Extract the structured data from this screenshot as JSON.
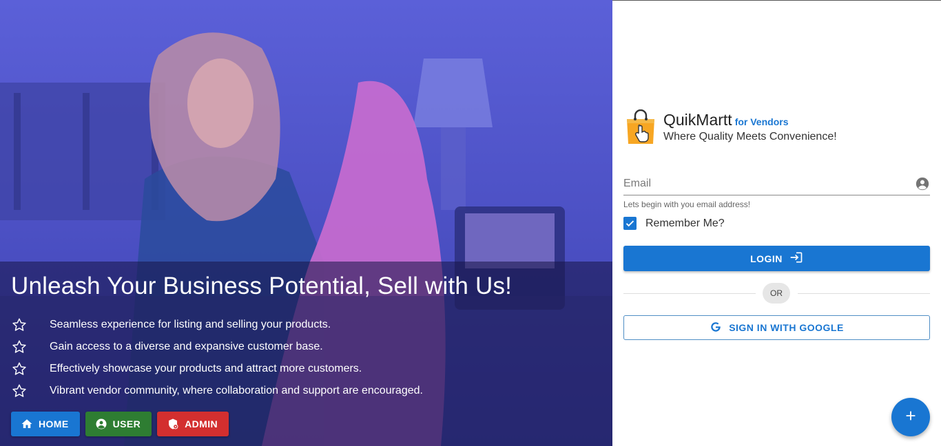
{
  "hero": {
    "title": "Unleash Your Business Potential, Sell with Us!",
    "features": [
      "Seamless experience for listing and selling your products.",
      "Gain access to a diverse and expansive customer base.",
      "Effectively showcase your products and attract more customers.",
      "Vibrant vendor community, where collaboration and support are encouraged."
    ],
    "feature_icon": "star-outline-icon",
    "buttons": {
      "home": "HOME",
      "user": "USER",
      "admin": "ADMIN"
    }
  },
  "brand": {
    "name": "QuikMartt",
    "suffix": "for Vendors",
    "tagline": "Where Quality Meets Convenience!",
    "logo_icon": "shopping-bag-hand-icon"
  },
  "form": {
    "email_placeholder": "Email",
    "email_value": "",
    "email_hint": "Lets begin with you email address!",
    "remember_label": "Remember Me?",
    "remember_checked": true,
    "login_label": "LOGIN",
    "or_label": "OR",
    "google_label": "SIGN IN WITH GOOGLE"
  },
  "colors": {
    "primary": "#1976d2",
    "success": "#2e7d32",
    "danger": "#d32f2f",
    "logo_orange": "#f7a623"
  }
}
